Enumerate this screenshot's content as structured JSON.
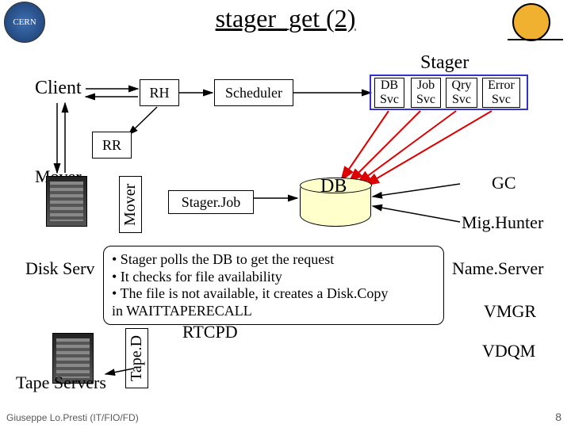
{
  "title": "stager_get (2)",
  "logo_left": "CERN",
  "labels": {
    "client": "Client",
    "stager_heading": "Stager",
    "rh": "RH",
    "scheduler": "Scheduler",
    "rr": "RR",
    "mover": "Mover",
    "mover_vert": "Mover",
    "stagerjob": "Stager.Job",
    "db": "DB",
    "gc": "GC",
    "mighunter": "Mig.Hunter",
    "nameserver": "Name.Server",
    "vmgr": "VMGR",
    "vdqm": "VDQM",
    "disk_servers": "Disk Serv",
    "rtcpd": "RTCPD",
    "tape_servers": "Tape Servers",
    "tape_vert": "Tape.D"
  },
  "svc": {
    "db": "DB\nSvc",
    "job": "Job\nSvc",
    "qry": "Qry\nSvc",
    "error": "Error\nSvc"
  },
  "callout": {
    "l1": "• Stager polls the DB to get the request",
    "l2": "• It checks for file availability",
    "l3": "• The file is not available, it creates a Disk.Copy",
    "l4": "   in WAITTAPERECALL"
  },
  "footer": "Giuseppe Lo.Presti (IT/FIO/FD)",
  "page": "8"
}
